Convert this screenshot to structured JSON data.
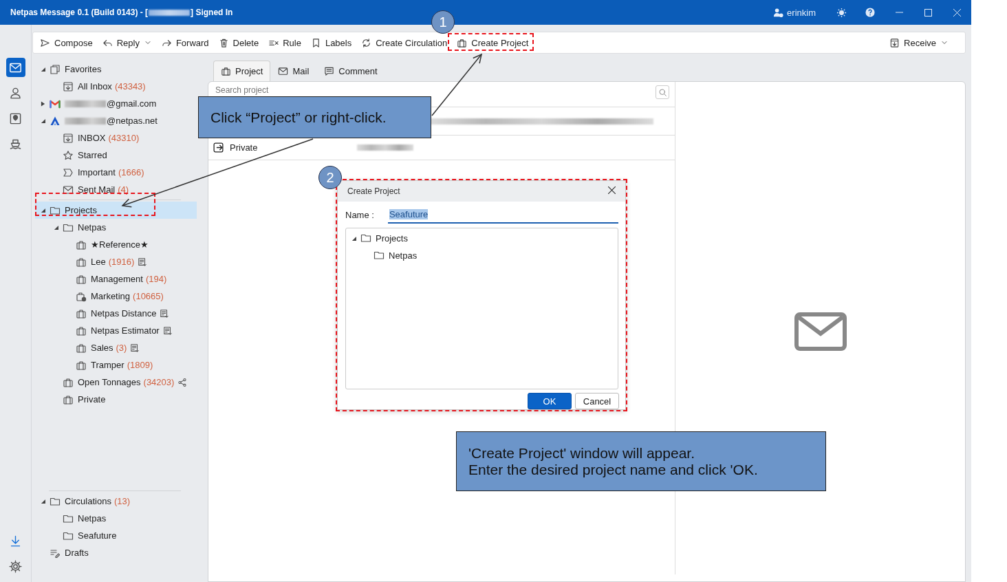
{
  "window": {
    "title_start": "Netpas Message 0.1 (Build 0143) - [",
    "title_end": "] Signed In",
    "user": "erinkim"
  },
  "rail": {
    "top": [
      {
        "kind": "mail",
        "selected": true
      },
      {
        "kind": "contacts",
        "selected": false
      },
      {
        "kind": "map",
        "selected": false
      },
      {
        "kind": "ship",
        "selected": false
      }
    ],
    "bottom": [
      {
        "kind": "download"
      },
      {
        "kind": "settings"
      }
    ]
  },
  "toolbar": {
    "items": [
      {
        "label": "Compose",
        "kind": "compose",
        "dropdown": false
      },
      {
        "label": "Reply",
        "kind": "reply",
        "dropdown": true
      },
      {
        "label": "Forward",
        "kind": "forward",
        "dropdown": false
      },
      {
        "label": "Delete",
        "kind": "delete",
        "dropdown": false
      },
      {
        "label": "Rule",
        "kind": "rule",
        "dropdown": false
      },
      {
        "label": "Labels",
        "kind": "labels",
        "dropdown": false
      },
      {
        "label": "Create Circulation",
        "kind": "circulation",
        "dropdown": false
      },
      {
        "label": "Create Project",
        "kind": "project",
        "dropdown": false
      }
    ],
    "right": {
      "label": "Receive",
      "kind": "receive",
      "dropdown": true
    }
  },
  "sidebar": {
    "sections": [
      {
        "items": [
          {
            "label": "Favorites",
            "kind": "favorites",
            "expanded": true,
            "selected": false,
            "children": [
              {
                "label": "All Inbox",
                "count": "(43343)",
                "kind": "inbox",
                "selected": false
              }
            ]
          },
          {
            "label": "@gmail.com",
            "redacted": true,
            "kind": "gmail",
            "expanded": false,
            "selected": false
          },
          {
            "label": "@netpas.net",
            "redacted": true,
            "kind": "netpas",
            "expanded": true,
            "selected": false,
            "children": [
              {
                "label": "INBOX",
                "count": "(43310)",
                "kind": "inbox",
                "selected": false
              },
              {
                "label": "Starred",
                "kind": "star",
                "selected": false
              },
              {
                "label": "Important",
                "count": "(1666)",
                "kind": "important",
                "selected": false
              },
              {
                "label": "Sent Mail",
                "count": "(4)",
                "kind": "sent",
                "selected": false
              }
            ]
          }
        ]
      },
      {
        "items": [
          {
            "label": "Projects",
            "kind": "folder",
            "expanded": true,
            "selected": true,
            "children": [
              {
                "label": "Netpas",
                "kind": "folder",
                "expanded": true,
                "selected": false,
                "children": [
                  {
                    "label": "★Reference★",
                    "kind": "project",
                    "selected": false
                  },
                  {
                    "label": "Lee",
                    "count": "(1916)",
                    "kind": "project",
                    "doc_mark": true,
                    "selected": false
                  },
                  {
                    "label": "Management",
                    "count": "(194)",
                    "kind": "project",
                    "selected": false
                  },
                  {
                    "label": "Marketing",
                    "count": "(10665)",
                    "kind": "project-gear",
                    "selected": false
                  },
                  {
                    "label": "Netpas Distance",
                    "kind": "project",
                    "doc_mark": true,
                    "selected": false
                  },
                  {
                    "label": "Netpas Estimator",
                    "kind": "project",
                    "doc_mark": true,
                    "selected": false
                  },
                  {
                    "label": "Sales",
                    "count": "(3)",
                    "kind": "project",
                    "doc_mark": true,
                    "selected": false
                  },
                  {
                    "label": "Tramper",
                    "count": "(1809)",
                    "kind": "project",
                    "selected": false
                  }
                ]
              },
              {
                "label": "Open Tonnages",
                "count": "(34203)",
                "kind": "project",
                "share_mark": true,
                "selected": false
              },
              {
                "label": "Private",
                "kind": "project",
                "selected": false
              }
            ]
          }
        ]
      },
      {
        "items": [
          {
            "label": "Circulations",
            "count": "(13)",
            "kind": "folder",
            "expanded": true,
            "selected": false,
            "children": [
              {
                "label": "Netpas",
                "kind": "folder",
                "selected": false
              },
              {
                "label": "Seafuture",
                "kind": "folder",
                "selected": false
              }
            ]
          },
          {
            "label": "Drafts",
            "kind": "drafts",
            "selected": false
          }
        ]
      }
    ]
  },
  "tabs": [
    {
      "label": "Project",
      "kind": "project",
      "selected": true
    },
    {
      "label": "Mail",
      "kind": "mail",
      "selected": false
    },
    {
      "label": "Comment",
      "kind": "comment",
      "selected": false
    }
  ],
  "search": {
    "placeholder": "Search project"
  },
  "rows": [
    {
      "redacted": true
    },
    {
      "label": "Private",
      "kind": "exit",
      "redacted": true
    }
  ],
  "dialog": {
    "title": "Create Project",
    "name_label": "Name :",
    "name_value": "Seafuture",
    "name_selected": true,
    "tree": [
      {
        "label": "Projects",
        "kind": "folder",
        "expanded": true,
        "children": [
          {
            "label": "Netpas",
            "kind": "folder"
          }
        ]
      }
    ],
    "buttons": [
      {
        "label": "OK",
        "primary": true
      },
      {
        "label": "Cancel",
        "primary": false
      }
    ]
  },
  "annotations": {
    "steps": [
      "1",
      "2"
    ],
    "callouts": [
      {
        "lines": [
          "Click “Project” or right-click."
        ]
      },
      {
        "lines": [
          "'Create Project' window will appear.",
          "Enter the desired project name and click 'OK."
        ]
      }
    ]
  }
}
